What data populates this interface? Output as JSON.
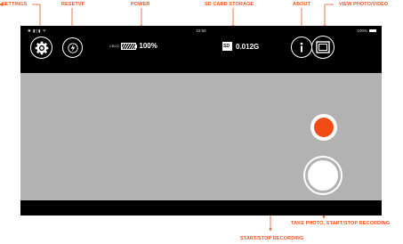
{
  "annotations": {
    "settings": "SETTINGS",
    "resetvf": "RESETVF",
    "power": "POWER",
    "sd_card_storage": "SD CARD STORAGE",
    "about": "ABOUT",
    "view_photo_video": "VIEW PHOTO/VIDEO",
    "take_photo": "TAKE PHOTO, START/STOP RECORDING",
    "start_stop_recording": "START/STOP RECORDING"
  },
  "status_bar": {
    "left": "",
    "time": "10:55",
    "right_battery": "100%"
  },
  "power": {
    "label": "CBO2",
    "value": "100%"
  },
  "storage": {
    "card_label": "SD",
    "value": "0.012G"
  },
  "colors": {
    "annotation": "#f0521f",
    "record": "#f24b16",
    "viewfinder": "#b2b2b2",
    "bezel": "#000000"
  },
  "icons": [
    "gear-icon",
    "flash-icon",
    "info-icon",
    "gallery-icon",
    "record-icon",
    "shutter-icon",
    "sd-card-icon",
    "battery-icon"
  ]
}
